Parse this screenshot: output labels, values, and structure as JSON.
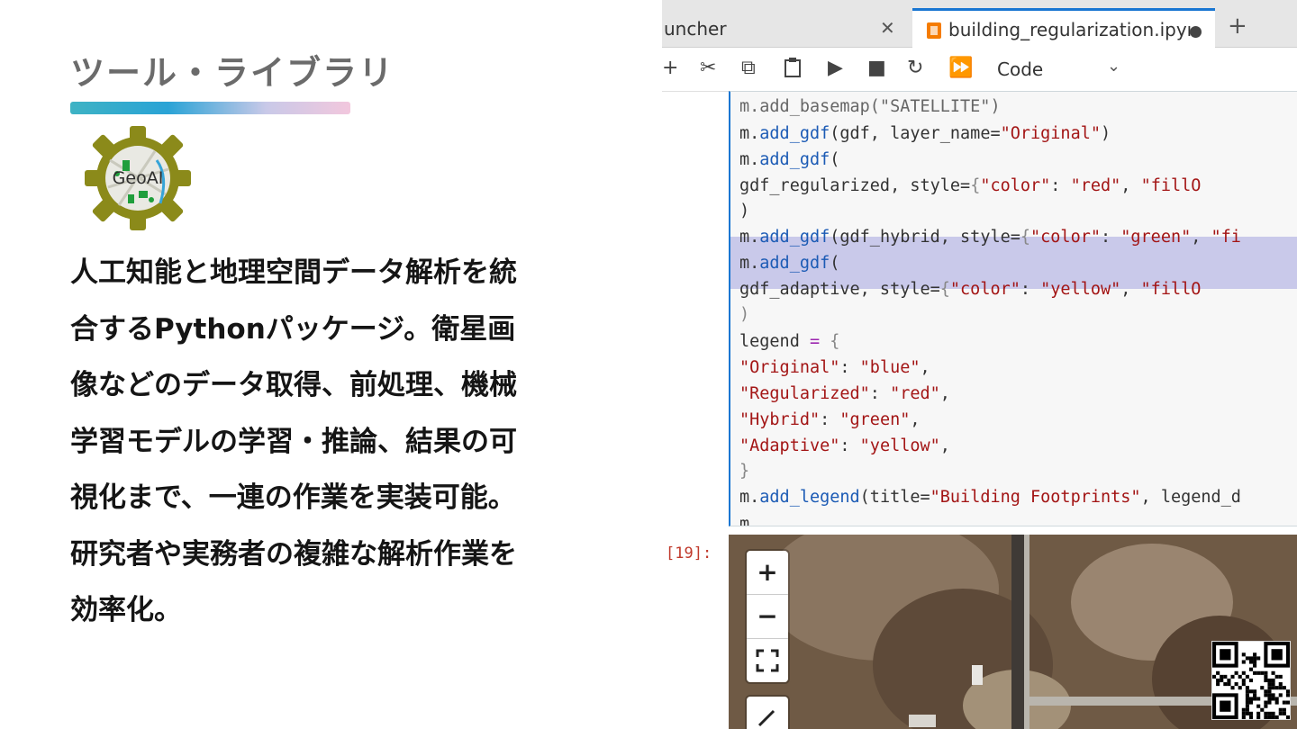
{
  "slide": {
    "title": "ツール・ライブラリ",
    "logo_text": "GeoAI",
    "description_lines": [
      "人工知能と地理空間データ解析を統",
      "合するPythonパッケージ。衛星画",
      "像などのデータ取得、前処理、機械",
      "学習モデルの学習・推論、結果の可",
      "視化まで、一連の作業を実装可能。",
      "研究者や実務者の複雑な解析作業を",
      "効率化。"
    ]
  },
  "jupyter": {
    "tabs": [
      {
        "label": "uncher",
        "close": "✕"
      },
      {
        "label": "building_regularization.ipyı",
        "active": true
      }
    ],
    "new_tab": "+",
    "toolbar": {
      "add": "+",
      "cut": "✂",
      "copy": "⧉",
      "paste": "📋",
      "run": "▶",
      "stop": "■",
      "restart": "↻",
      "run_all": "⏩",
      "cell_type": "Code"
    },
    "output_prompt": "[19]:",
    "map_controls": {
      "zoom_in": "+",
      "zoom_out": "−",
      "fullscreen": "⛶",
      "draw": "⟋"
    }
  },
  "colors": {
    "title_gray": "#6b6b6b",
    "accent_blue": "#1976d2",
    "highlight": "#c9c9ea",
    "logo_olive": "#8b8a1a"
  }
}
